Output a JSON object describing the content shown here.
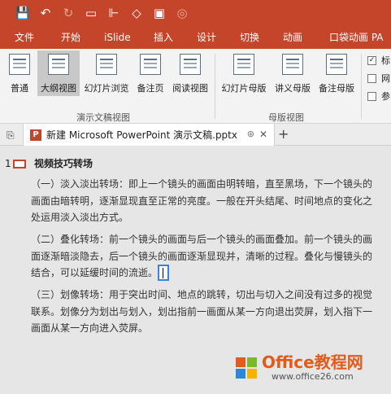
{
  "quick_access": {
    "save_icon": "save-icon",
    "undo_icon": "undo-icon",
    "redo_icon": "redo-icon",
    "present_icon": "slideshow-icon",
    "format_icon": "format-painter-icon",
    "shapes_icon": "shapes-icon",
    "image_icon": "image-icon",
    "record_icon": "record-icon"
  },
  "tabs": [
    "文件",
    "开始",
    "iSlide",
    "插入",
    "设计",
    "切换",
    "动画",
    "口袋动画 PA"
  ],
  "ribbon": {
    "buttons": [
      {
        "label": "普通",
        "active": false
      },
      {
        "label": "大纲视图",
        "active": true
      },
      {
        "label": "幻灯片浏览",
        "active": false
      },
      {
        "label": "备注页",
        "active": false
      },
      {
        "label": "阅读视图",
        "active": false
      },
      {
        "label": "幻灯片母版",
        "active": false
      },
      {
        "label": "讲义母版",
        "active": false
      },
      {
        "label": "备注母版",
        "active": false
      }
    ],
    "groups": [
      "演示文稿视图",
      "母版视图"
    ],
    "checks": [
      {
        "label": "标",
        "checked": true
      },
      {
        "label": "网",
        "checked": false
      },
      {
        "label": "参",
        "checked": false
      }
    ]
  },
  "document": {
    "tab_title": "新建 Microsoft PowerPoint 演示文稿.pptx",
    "close": "✕",
    "plus": "+",
    "icon_letter": "P"
  },
  "outline": {
    "slide_number": "1",
    "title": "视频技巧转场",
    "paragraphs": [
      "（一）淡入淡出转场：即上一个镜头的画面由明转暗，直至黑场，下一个镜头的画面由暗转明，逐渐显现直至正常的亮度。一般在开头结尾、时间地点的变化之处运用淡入淡出方式。",
      "（二）叠化转场：前一个镜头的画面与后一个镜头的画面叠加。前一个镜头的画面逐渐暗淡隐去，后一个镜头的画面逐渐显现并，清晰的过程。叠化与慢镜头的结合，可以延缓时间的流逝。",
      "（三）划像转场：用于突出时间、地点的跳转，切出与切入之间没有过多的视觉联系。划像分为划出与划入，划出指前一画面从某一方向退出荧屏，划入指下一画面从某一方向进入荧屏。"
    ]
  },
  "watermark": {
    "brand": "Office教程网",
    "url": "www.office26.com"
  }
}
